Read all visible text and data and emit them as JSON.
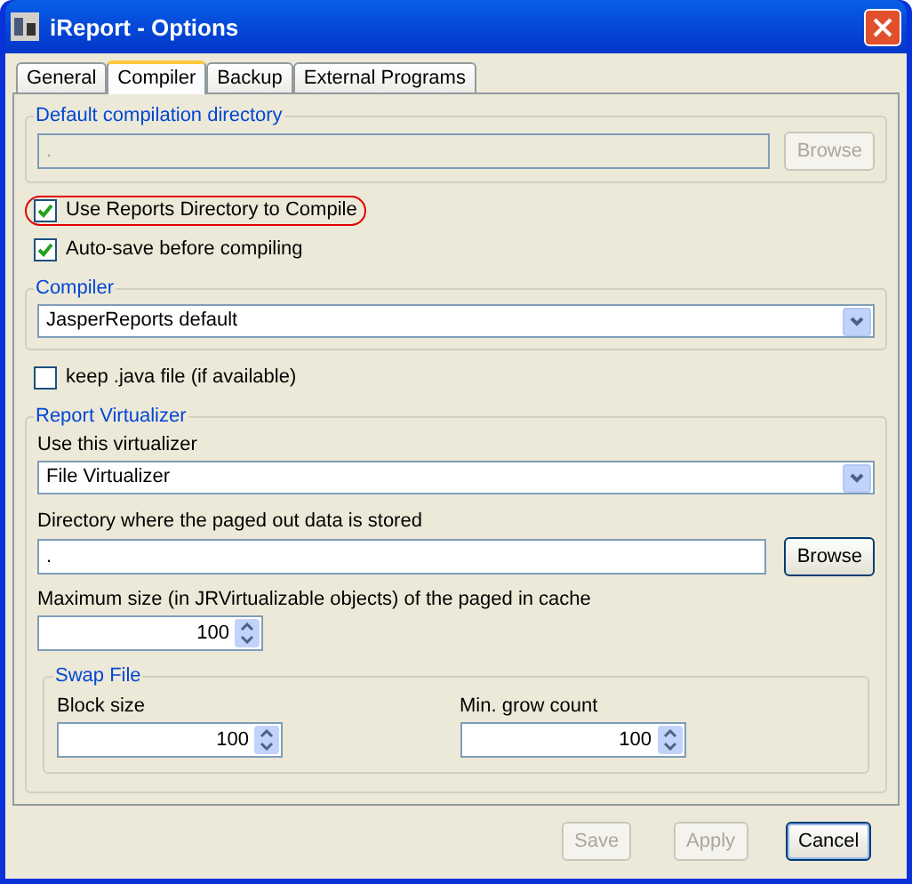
{
  "window": {
    "title": "iReport - Options"
  },
  "tabs": [
    {
      "label": "General",
      "selected": false
    },
    {
      "label": "Compiler",
      "selected": true
    },
    {
      "label": "Backup",
      "selected": false
    },
    {
      "label": "External Programs",
      "selected": false
    }
  ],
  "default_directory": {
    "title": "Default compilation directory",
    "value": ".",
    "disabled": true,
    "browse": {
      "label": "Browse",
      "disabled": true,
      "default": false
    }
  },
  "options": [
    {
      "label": "Use Reports Directory to Compile",
      "checked": true,
      "highlighted": true
    },
    {
      "label": "Auto-save before compiling",
      "checked": true,
      "highlighted": false
    }
  ],
  "compiler": {
    "title": "Compiler",
    "value": "JasperReports default"
  },
  "keep_java": {
    "label": "keep .java file (if available)",
    "checked": false,
    "highlighted": false
  },
  "virtualizer": {
    "title": "Report Virtualizer",
    "type_label": "Use this virtualizer",
    "type_value": "File Virtualizer",
    "directory_label": "Directory where the paged out data is stored",
    "directory_value": ".",
    "browse": {
      "label": "Browse",
      "disabled": false,
      "default": false
    },
    "cache_label": "Maximum size (in JRVirtualizable objects) of the paged in cache",
    "cache_value": "100",
    "swap": {
      "title": "Swap File",
      "block_label": "Block size",
      "block_value": "100",
      "grow_label": "Min. grow count",
      "grow_value": "100"
    }
  },
  "buttons": [
    {
      "label": "Save",
      "disabled": true,
      "default": false
    },
    {
      "label": "Apply",
      "disabled": true,
      "default": false
    },
    {
      "label": "Cancel",
      "disabled": false,
      "default": true
    }
  ]
}
